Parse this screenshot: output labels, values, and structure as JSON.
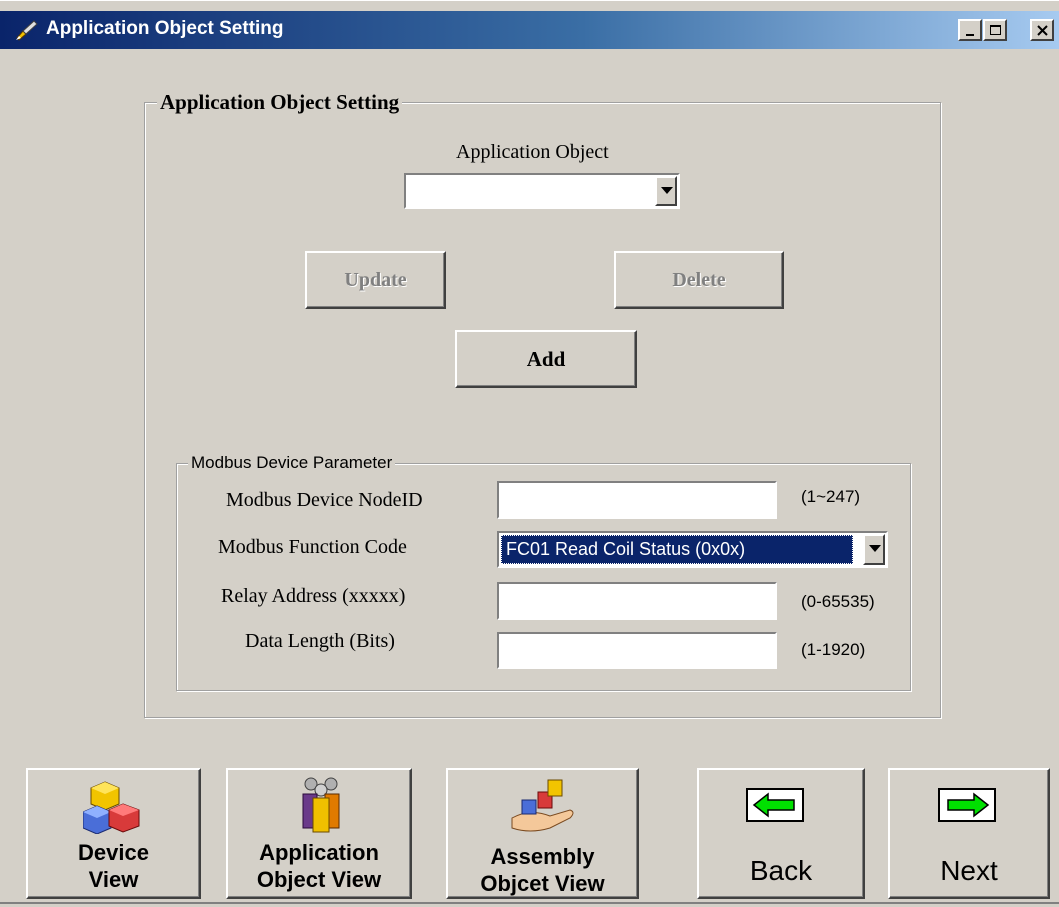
{
  "window": {
    "title": "Application Object Setting",
    "minimize_icon": "minimize-icon",
    "maximize_icon": "maximize-icon",
    "close_icon": "close-icon"
  },
  "main_group": {
    "legend": "Application Object Setting",
    "app_object_label": "Application Object",
    "app_object_value": "",
    "update_label": "Update",
    "delete_label": "Delete",
    "add_label": "Add"
  },
  "modbus_group": {
    "legend": "Modbus Device Parameter",
    "node_id_label": "Modbus Device NodeID",
    "node_id_value": "",
    "node_id_range": "(1~247)",
    "function_code_label": "Modbus Function Code",
    "function_code_value": "FC01 Read Coil Status (0x0x)",
    "relay_address_label": "Relay Address (xxxxx)",
    "relay_address_value": "",
    "relay_address_range": "(0-65535)",
    "data_length_label": "Data Length (Bits)",
    "data_length_value": "",
    "data_length_range": "(1-1920)"
  },
  "nav_buttons": {
    "device_view_line1": "Device",
    "device_view_line2": "View",
    "app_object_view_line1": "Application",
    "app_object_view_line2": "Object View",
    "assembly_view_line1": "Assembly",
    "assembly_view_line2": "Objcet View",
    "back_label": "Back",
    "next_label": "Next"
  },
  "colors": {
    "face": "#d4d0c8",
    "selection": "#0a246a",
    "arrow_green": "#00e000"
  }
}
